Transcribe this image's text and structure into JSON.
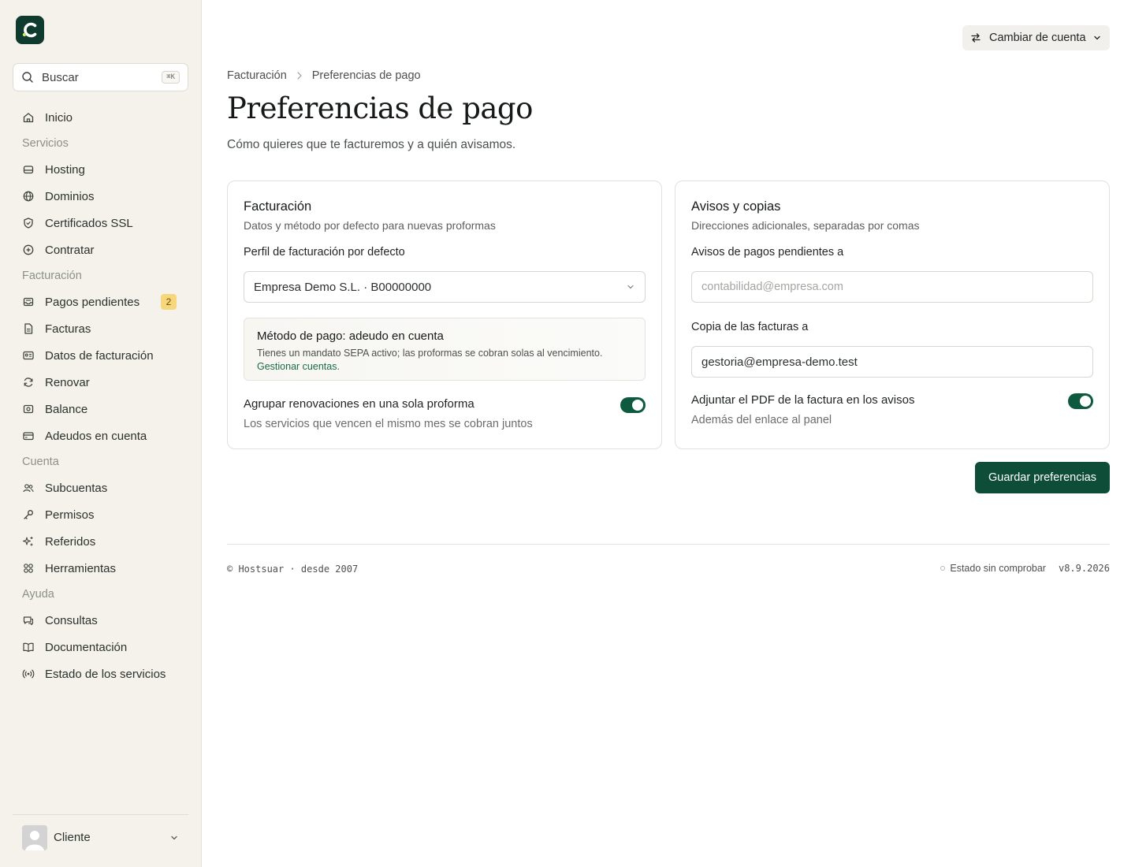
{
  "sidebar": {
    "search_label": "Buscar",
    "search_shortcut": "⌘K",
    "items": [
      {
        "type": "item",
        "label": "Inicio",
        "icon": "home-icon"
      },
      {
        "type": "section",
        "label": "Servicios"
      },
      {
        "type": "item",
        "label": "Hosting",
        "icon": "server-icon"
      },
      {
        "type": "item",
        "label": "Dominios",
        "icon": "globe-icon"
      },
      {
        "type": "item",
        "label": "Certificados SSL",
        "icon": "shield-icon"
      },
      {
        "type": "item",
        "label": "Contratar",
        "icon": "plus-circle-icon"
      },
      {
        "type": "section",
        "label": "Facturación"
      },
      {
        "type": "item",
        "label": "Pagos pendientes",
        "icon": "inbox-icon",
        "badge": "2"
      },
      {
        "type": "item",
        "label": "Facturas",
        "icon": "file-icon"
      },
      {
        "type": "item",
        "label": "Datos de facturación",
        "icon": "id-card-icon"
      },
      {
        "type": "item",
        "label": "Renovar",
        "icon": "refresh-icon"
      },
      {
        "type": "item",
        "label": "Balance",
        "icon": "wallet-icon"
      },
      {
        "type": "item",
        "label": "Adeudos en cuenta",
        "icon": "credit-card-icon"
      },
      {
        "type": "section",
        "label": "Cuenta"
      },
      {
        "type": "item",
        "label": "Subcuentas",
        "icon": "users-icon"
      },
      {
        "type": "item",
        "label": "Permisos",
        "icon": "key-icon"
      },
      {
        "type": "item",
        "label": "Referidos",
        "icon": "sparkle-icon"
      },
      {
        "type": "item",
        "label": "Herramientas",
        "icon": "grid-icon"
      },
      {
        "type": "section",
        "label": "Ayuda"
      },
      {
        "type": "item",
        "label": "Consultas",
        "icon": "chat-icon"
      },
      {
        "type": "item",
        "label": "Documentación",
        "icon": "book-icon"
      },
      {
        "type": "item",
        "label": "Estado de los servicios",
        "icon": "broadcast-icon"
      }
    ],
    "user_name": "Cliente"
  },
  "header": {
    "switch_account_label": "Cambiar de cuenta"
  },
  "breadcrumb": {
    "parent": "Facturación",
    "current": "Preferencias de pago"
  },
  "page": {
    "title": "Preferencias de pago",
    "subtitle": "Cómo quieres que te facturemos y a quién avisamos."
  },
  "billing_card": {
    "title": "Facturación",
    "description": "Datos y método por defecto para nuevas proformas",
    "profile_label": "Perfil de facturación por defecto",
    "profile_value": "Empresa Demo S.L. · B00000000",
    "method_title": "Método de pago: adeudo en cuenta",
    "method_text": "Tienes un mandato SEPA activo; las proformas se cobran solas al vencimiento.",
    "method_link": "Gestionar cuentas.",
    "group_label": "Agrupar renovaciones en una sola proforma",
    "group_help": "Los servicios que vencen el mismo mes se cobran juntos",
    "group_enabled": true
  },
  "notices_card": {
    "title": "Avisos y copias",
    "description": "Direcciones adicionales, separadas por comas",
    "pending_label": "Avisos de pagos pendientes a",
    "pending_placeholder": "contabilidad@empresa.com",
    "pending_value": "",
    "copy_label": "Copia de las facturas a",
    "copy_value": "gestoria@empresa-demo.test",
    "attach_label": "Adjuntar el PDF de la factura en los avisos",
    "attach_help": "Además del enlace al panel",
    "attach_enabled": true
  },
  "actions": {
    "save_label": "Guardar preferencias"
  },
  "footer": {
    "copyright": "© Hostsuar · desde 2007",
    "status": "Estado sin comprobar",
    "version": "v8.9.2026"
  },
  "colors": {
    "brand": "#0e3b2e",
    "accent_green": "#0e4d37",
    "sidebar_bg": "#f4f2eb",
    "badge_bg": "#f6d77c"
  }
}
